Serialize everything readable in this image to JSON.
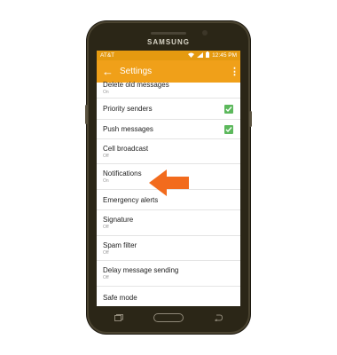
{
  "device": {
    "brand": "SAMSUNG"
  },
  "statusbar": {
    "carrier": "AT&T",
    "time": "12:45 PM"
  },
  "appbar": {
    "title": "Settings"
  },
  "settings": [
    {
      "title": "Delete old messages",
      "subtitle": "On",
      "checkbox": false
    },
    {
      "title": "Priority senders",
      "subtitle": "",
      "checkbox": true
    },
    {
      "title": "Push messages",
      "subtitle": "",
      "checkbox": true
    },
    {
      "title": "Cell broadcast",
      "subtitle": "Off",
      "checkbox": false
    },
    {
      "title": "Notifications",
      "subtitle": "On",
      "checkbox": false
    },
    {
      "title": "Emergency alerts",
      "subtitle": "",
      "checkbox": false
    },
    {
      "title": "Signature",
      "subtitle": "Off",
      "checkbox": false
    },
    {
      "title": "Spam filter",
      "subtitle": "Off",
      "checkbox": false
    },
    {
      "title": "Delay message sending",
      "subtitle": "Off",
      "checkbox": false
    },
    {
      "title": "Safe mode",
      "subtitle": "",
      "checkbox": false
    }
  ],
  "colors": {
    "accent": "#f0a019",
    "checkbox": "#5cb85c",
    "pointer_arrow": "#f26b1d"
  }
}
